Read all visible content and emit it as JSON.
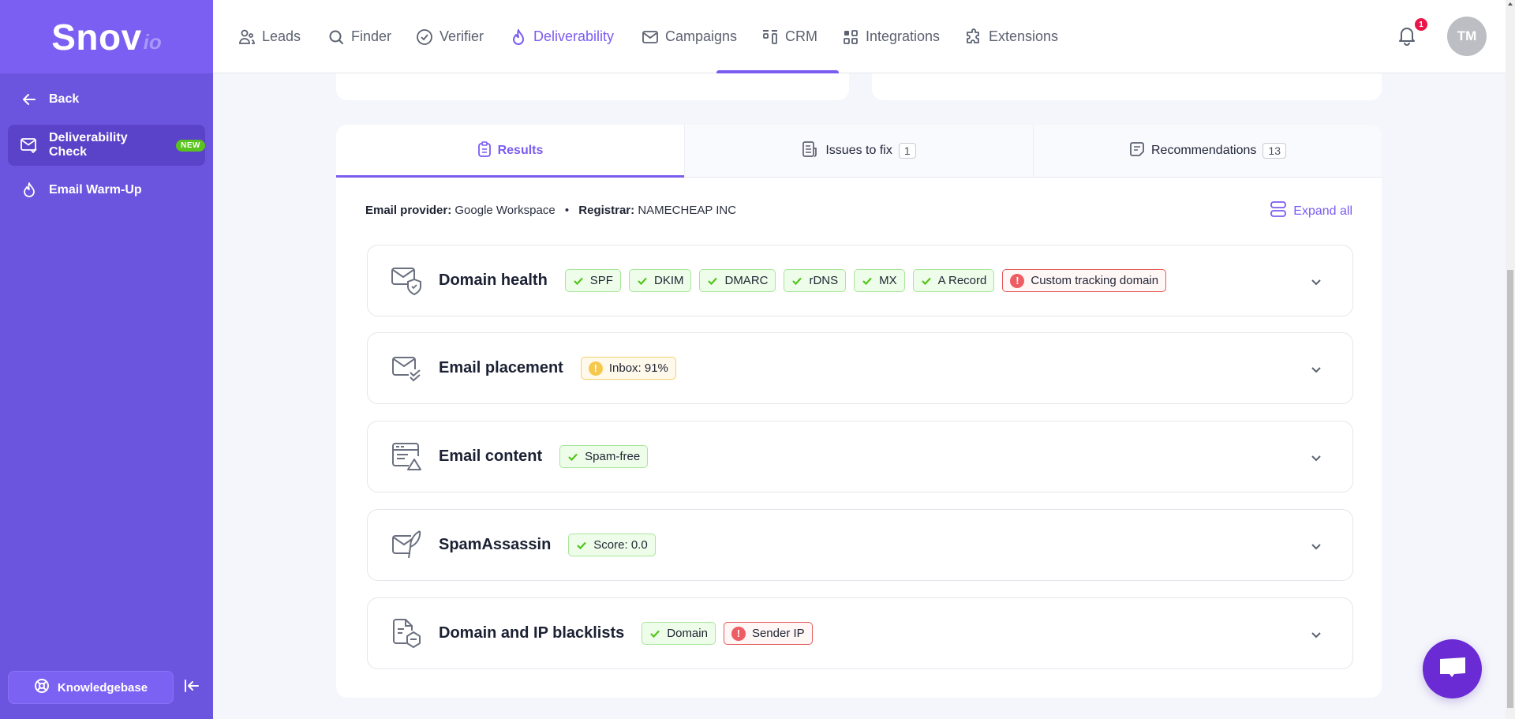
{
  "sidebar": {
    "logo_main": "Snov",
    "logo_suffix": "io",
    "back_label": "Back",
    "items": [
      {
        "label": "Deliverability Check",
        "badge": "NEW",
        "icon": "mail-check-icon",
        "active": true
      },
      {
        "label": "Email Warm-Up",
        "icon": "flame-icon",
        "active": false
      }
    ],
    "knowledgebase_label": "Knowledgebase"
  },
  "topnav": {
    "items": [
      {
        "label": "Leads",
        "icon": "users-icon"
      },
      {
        "label": "Finder",
        "icon": "search-icon"
      },
      {
        "label": "Verifier",
        "icon": "check-circle-icon"
      },
      {
        "label": "Deliverability",
        "icon": "flame-icon",
        "active": true
      },
      {
        "label": "Campaigns",
        "icon": "mail-icon"
      },
      {
        "label": "CRM",
        "icon": "crm-icon"
      },
      {
        "label": "Integrations",
        "icon": "grid-icon"
      },
      {
        "label": "Extensions",
        "icon": "puzzle-icon"
      }
    ],
    "notification_count": "1",
    "avatar_initials": "TM"
  },
  "tabs": [
    {
      "label": "Results",
      "active": true
    },
    {
      "label": "Issues to fix",
      "count": "1"
    },
    {
      "label": "Recommendations",
      "count": "13"
    }
  ],
  "info": {
    "provider_label": "Email provider:",
    "provider_value": "Google Workspace",
    "separator": "•",
    "registrar_label": "Registrar:",
    "registrar_value": "NAMECHEAP INC"
  },
  "expand_all_label": "Expand all",
  "sections": [
    {
      "title": "Domain health",
      "pills": [
        {
          "label": "SPF",
          "status": "ok"
        },
        {
          "label": "DKIM",
          "status": "ok"
        },
        {
          "label": "DMARC",
          "status": "ok"
        },
        {
          "label": "rDNS",
          "status": "ok"
        },
        {
          "label": "MX",
          "status": "ok"
        },
        {
          "label": "A Record",
          "status": "ok"
        },
        {
          "label": "Custom tracking domain",
          "status": "error"
        }
      ]
    },
    {
      "title": "Email placement",
      "pills": [
        {
          "label": "Inbox: 91%",
          "status": "warning"
        }
      ]
    },
    {
      "title": "Email content",
      "pills": [
        {
          "label": "Spam-free",
          "status": "ok"
        }
      ]
    },
    {
      "title": "SpamAssassin",
      "pills": [
        {
          "label": "Score: 0.0",
          "status": "ok"
        }
      ]
    },
    {
      "title": "Domain and IP blacklists",
      "pills": [
        {
          "label": "Domain",
          "status": "ok"
        },
        {
          "label": "Sender IP",
          "status": "error"
        }
      ]
    }
  ],
  "colors": {
    "accent": "#7b5cf0",
    "sidebar": "#6c55de",
    "ok": "#52c41a",
    "error": "#ee5d63",
    "warning": "#f6c94d",
    "chat": "#6a2bd4"
  }
}
